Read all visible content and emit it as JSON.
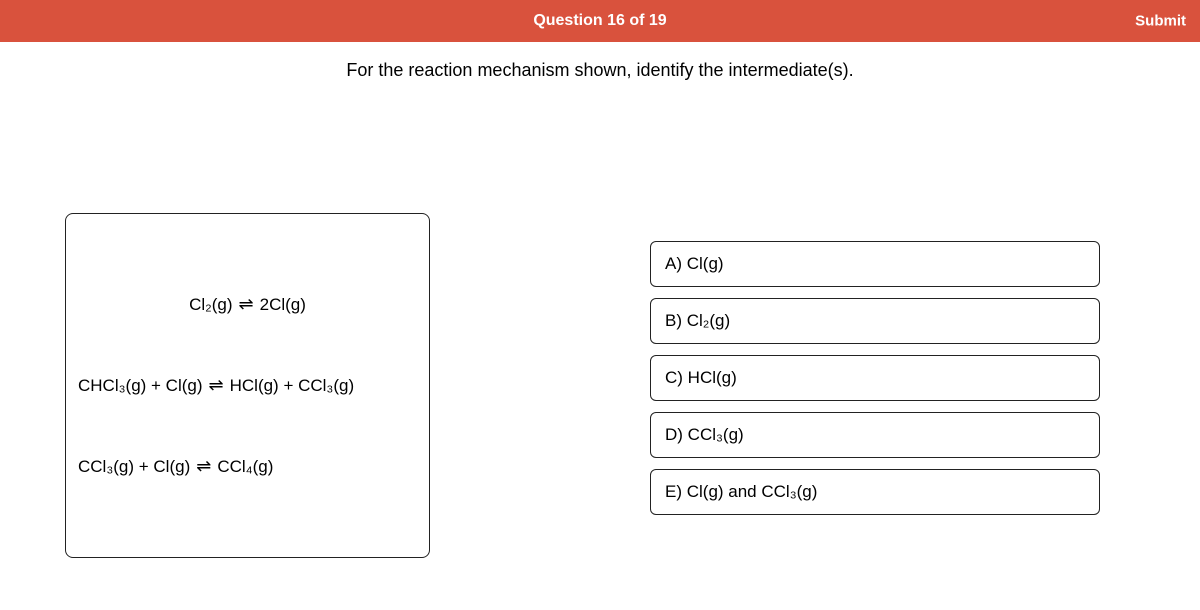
{
  "header": {
    "title": "Question 16 of 19",
    "submit": "Submit"
  },
  "prompt": "For the reaction mechanism shown, identify the intermediate(s).",
  "mechanism": {
    "r1_lhs": "Cl₂(g)",
    "r1_rhs": "2Cl(g)",
    "r2_lhs": "CHCl₃(g)  +   Cl(g)",
    "r2_rhs": "HCl(g)  +   CCl₃(g)",
    "r3_lhs": "CCl₃(g)  +   Cl(g)",
    "r3_rhs": "CCl₄(g)"
  },
  "answers": {
    "a": "A) Cl(g)",
    "b": "B) Cl₂(g)",
    "c": "C) HCl(g)",
    "d": "D) CCl₃(g)",
    "e": "E) Cl(g) and CCl₃(g)"
  }
}
